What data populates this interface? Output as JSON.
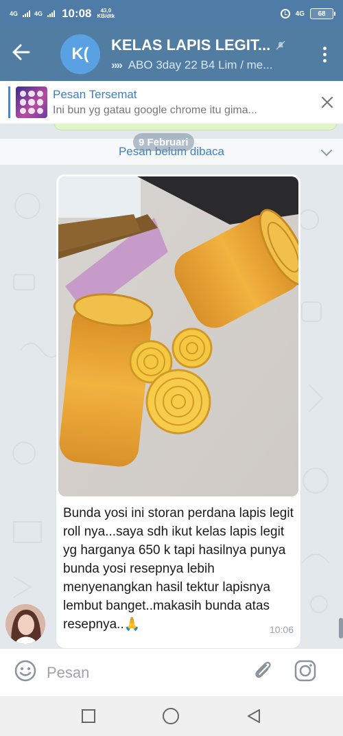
{
  "status_bar": {
    "sig1": "4G",
    "sig2": "4G",
    "time": "10:08",
    "net_speed_value": "43,0",
    "net_speed_unit": "KB/dtk",
    "network": "4G",
    "battery": "68"
  },
  "header": {
    "avatar_initials": "K(",
    "title": "KELAS LAPIS LEGIT...",
    "subtitle": "ABO 3day 22 B4 Lim / me...",
    "subtitle_prefix": "»»"
  },
  "pinned": {
    "label": "Pesan Tersemat",
    "preview": "Ini bun yg gatau google chrome itu gima..."
  },
  "chat": {
    "date_pill": "9 Februari",
    "unread_label": "Pesan belum dibaca",
    "message": {
      "text": "Bunda yosi ini storan perdana lapis legit roll nya...saya sdh ikut kelas lapis legit yg harganya 650 k tapi hasilnya punya bunda yosi resepnya lebih menyenangkan hasil tektur lapisnya lembut banget..makasih bunda atas resepnya..🙏",
      "time": "10:06"
    }
  },
  "composer": {
    "placeholder": "Pesan"
  },
  "colors": {
    "header": "#517da2",
    "status_bar": "#4f7ca6",
    "accent": "#3d89d3",
    "chat_bg": "#e3e8ec"
  },
  "icons": {
    "back": "arrow-left-icon",
    "mute": "muted-bell-icon",
    "menu": "more-vertical-icon",
    "pin_close": "close-icon",
    "chevron": "chevron-down-icon",
    "emoji": "smiley-icon",
    "attach": "paperclip-icon",
    "camera": "instagram-camera-icon",
    "nav_recent": "square-icon",
    "nav_home": "circle-icon",
    "nav_back": "triangle-back-icon"
  }
}
